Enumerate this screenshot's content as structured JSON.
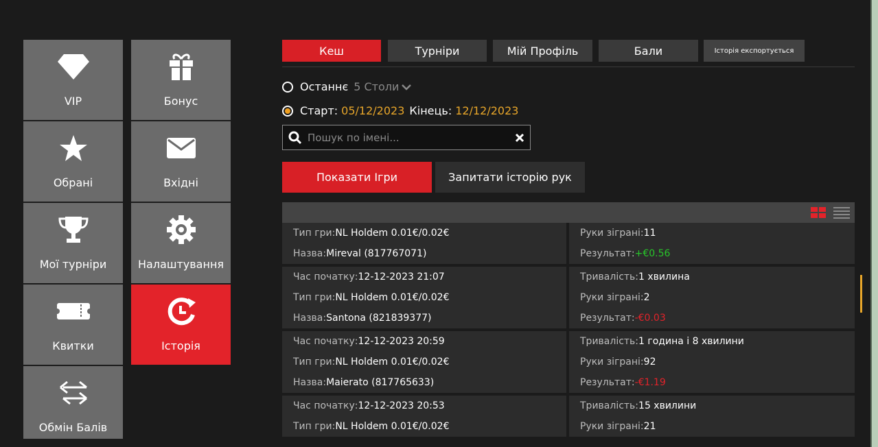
{
  "sidebar": {
    "tiles": [
      {
        "label": "VIP",
        "icon": "diamond-icon"
      },
      {
        "label": "Бонус",
        "icon": "gift-icon"
      },
      {
        "label": "Обрані",
        "icon": "star-icon"
      },
      {
        "label": "Вхідні",
        "icon": "envelope-icon"
      },
      {
        "label": "Мої турніри",
        "icon": "trophy-icon"
      },
      {
        "label": "Налаштування",
        "icon": "gear-icon"
      },
      {
        "label": "Квитки",
        "icon": "ticket-icon"
      },
      {
        "label": "Історія",
        "icon": "history-icon"
      },
      {
        "label": "Обмін Балів",
        "icon": "exchange-icon"
      }
    ],
    "active": "Історія",
    "active_color": "#e3232a"
  },
  "tabs": {
    "cash": "Кеш",
    "tournaments": "Турніри",
    "profile": "Мій Профіль",
    "points": "Бали",
    "export": "Історія експортується"
  },
  "filters": {
    "last_label": "Останнє",
    "last_count": "5 Столи",
    "start_label": "Старт:",
    "start_date": "05/12/2023",
    "end_label": "Кінець:",
    "end_date": "12/12/2023"
  },
  "search": {
    "placeholder": "Пошук по імені..."
  },
  "buttons": {
    "show_games": "Показати Ігри",
    "request_history": "Запитати історію рук"
  },
  "labels": {
    "start_time": "Час початку: ",
    "game_type": "Тип гри: ",
    "name": "Назва: ",
    "duration": "Тривалість: ",
    "hands": "Руки зіграні: ",
    "result": "Результат: "
  },
  "records": [
    {
      "game_type": "NL Holdem 0.01€/0.02€",
      "name": "Mireval (817767071)",
      "hands": "11",
      "result": "+€0.56"
    },
    {
      "start_time": "12-12-2023 21:07",
      "duration": "1 хвилина",
      "game_type": "NL Holdem 0.01€/0.02€",
      "hands": "2",
      "name": "Santona (821839377)",
      "result": "-€0.03"
    },
    {
      "start_time": "12-12-2023 20:59",
      "duration": "1 година і 8 хвилини",
      "game_type": "NL Holdem 0.01€/0.02€",
      "hands": "92",
      "name": "Maierato (817765633)",
      "result": "-€1.19"
    },
    {
      "start_time": "12-12-2023 20:53",
      "duration": "15 хвилини",
      "game_type": "NL Holdem 0.01€/0.02€",
      "hands": "21"
    }
  ],
  "colors": {
    "accent": "#d82026",
    "positive": "#28c52a",
    "negative": "#e3232a",
    "date": "#e8a62a"
  }
}
